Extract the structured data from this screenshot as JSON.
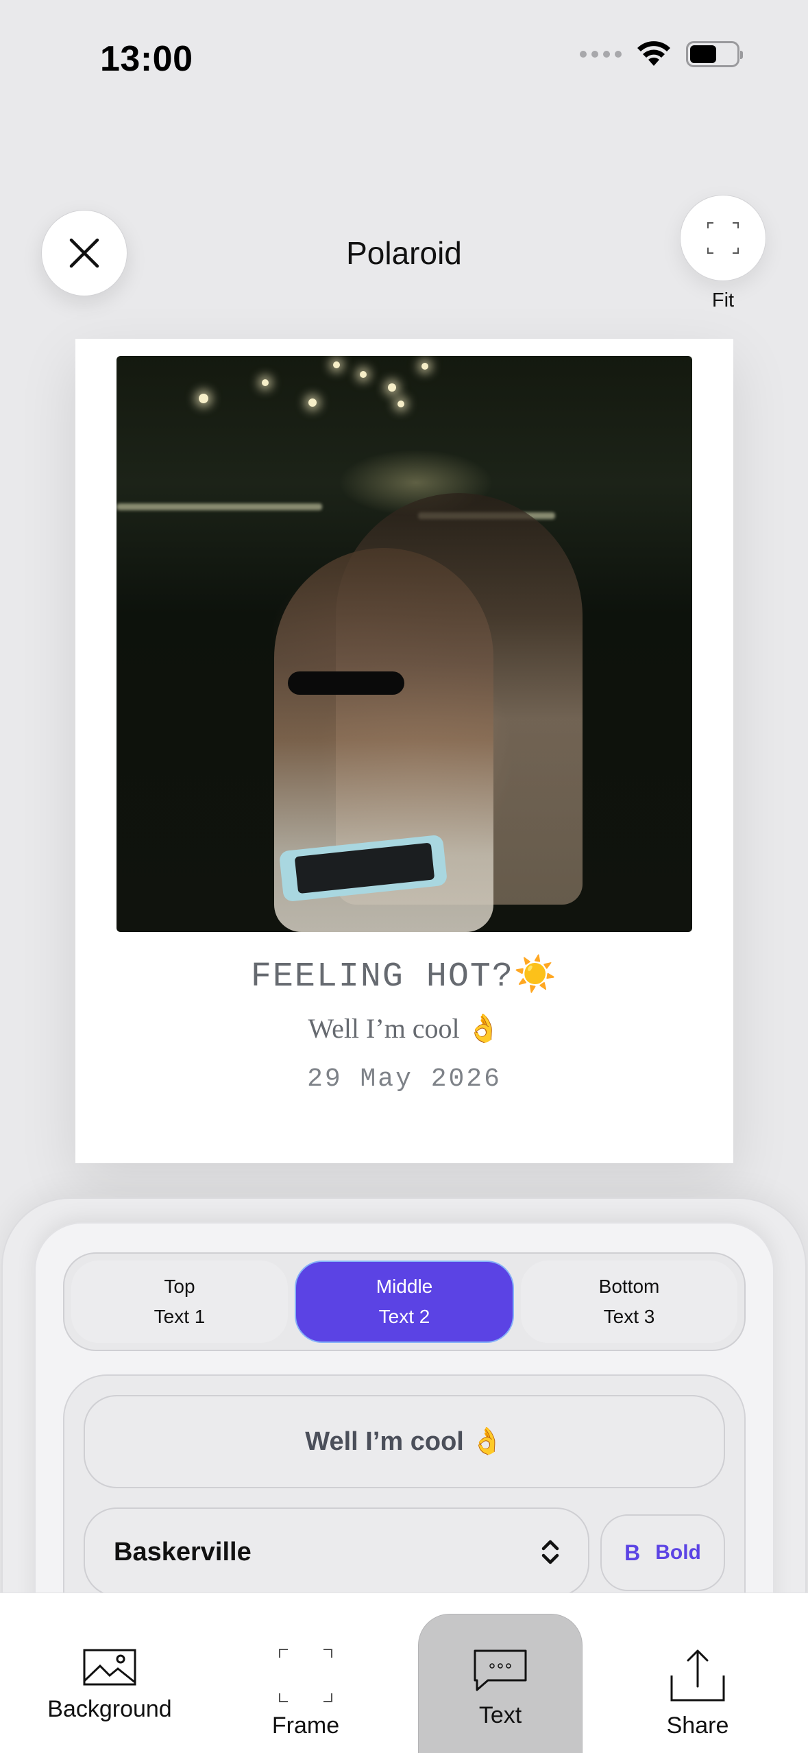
{
  "status_bar": {
    "time": "13:00"
  },
  "header": {
    "title": "Polaroid",
    "fit_label": "Fit"
  },
  "polaroid": {
    "line1": "FEELING HOT?☀️",
    "line2": "Well I’m cool 👌",
    "line3": "29 May 2026"
  },
  "segments": [
    {
      "position": "Top",
      "label": "Text 1",
      "active": false
    },
    {
      "position": "Middle",
      "label": "Text 2",
      "active": true
    },
    {
      "position": "Bottom",
      "label": "Text 3",
      "active": false
    }
  ],
  "editor": {
    "text_value": "Well I’m cool 👌",
    "font_value": "Baskerville",
    "bold_icon": "B",
    "bold_label": "Bold"
  },
  "tabbar": {
    "items": [
      {
        "label": "Background",
        "icon": "image-icon"
      },
      {
        "label": "Frame",
        "icon": "frame-icon"
      },
      {
        "label": "Text",
        "icon": "text-bubble-icon",
        "active": true
      },
      {
        "label": "Share",
        "icon": "share-icon"
      }
    ]
  },
  "colors": {
    "accent": "#5b43e4",
    "background": "#e9e9eb"
  }
}
